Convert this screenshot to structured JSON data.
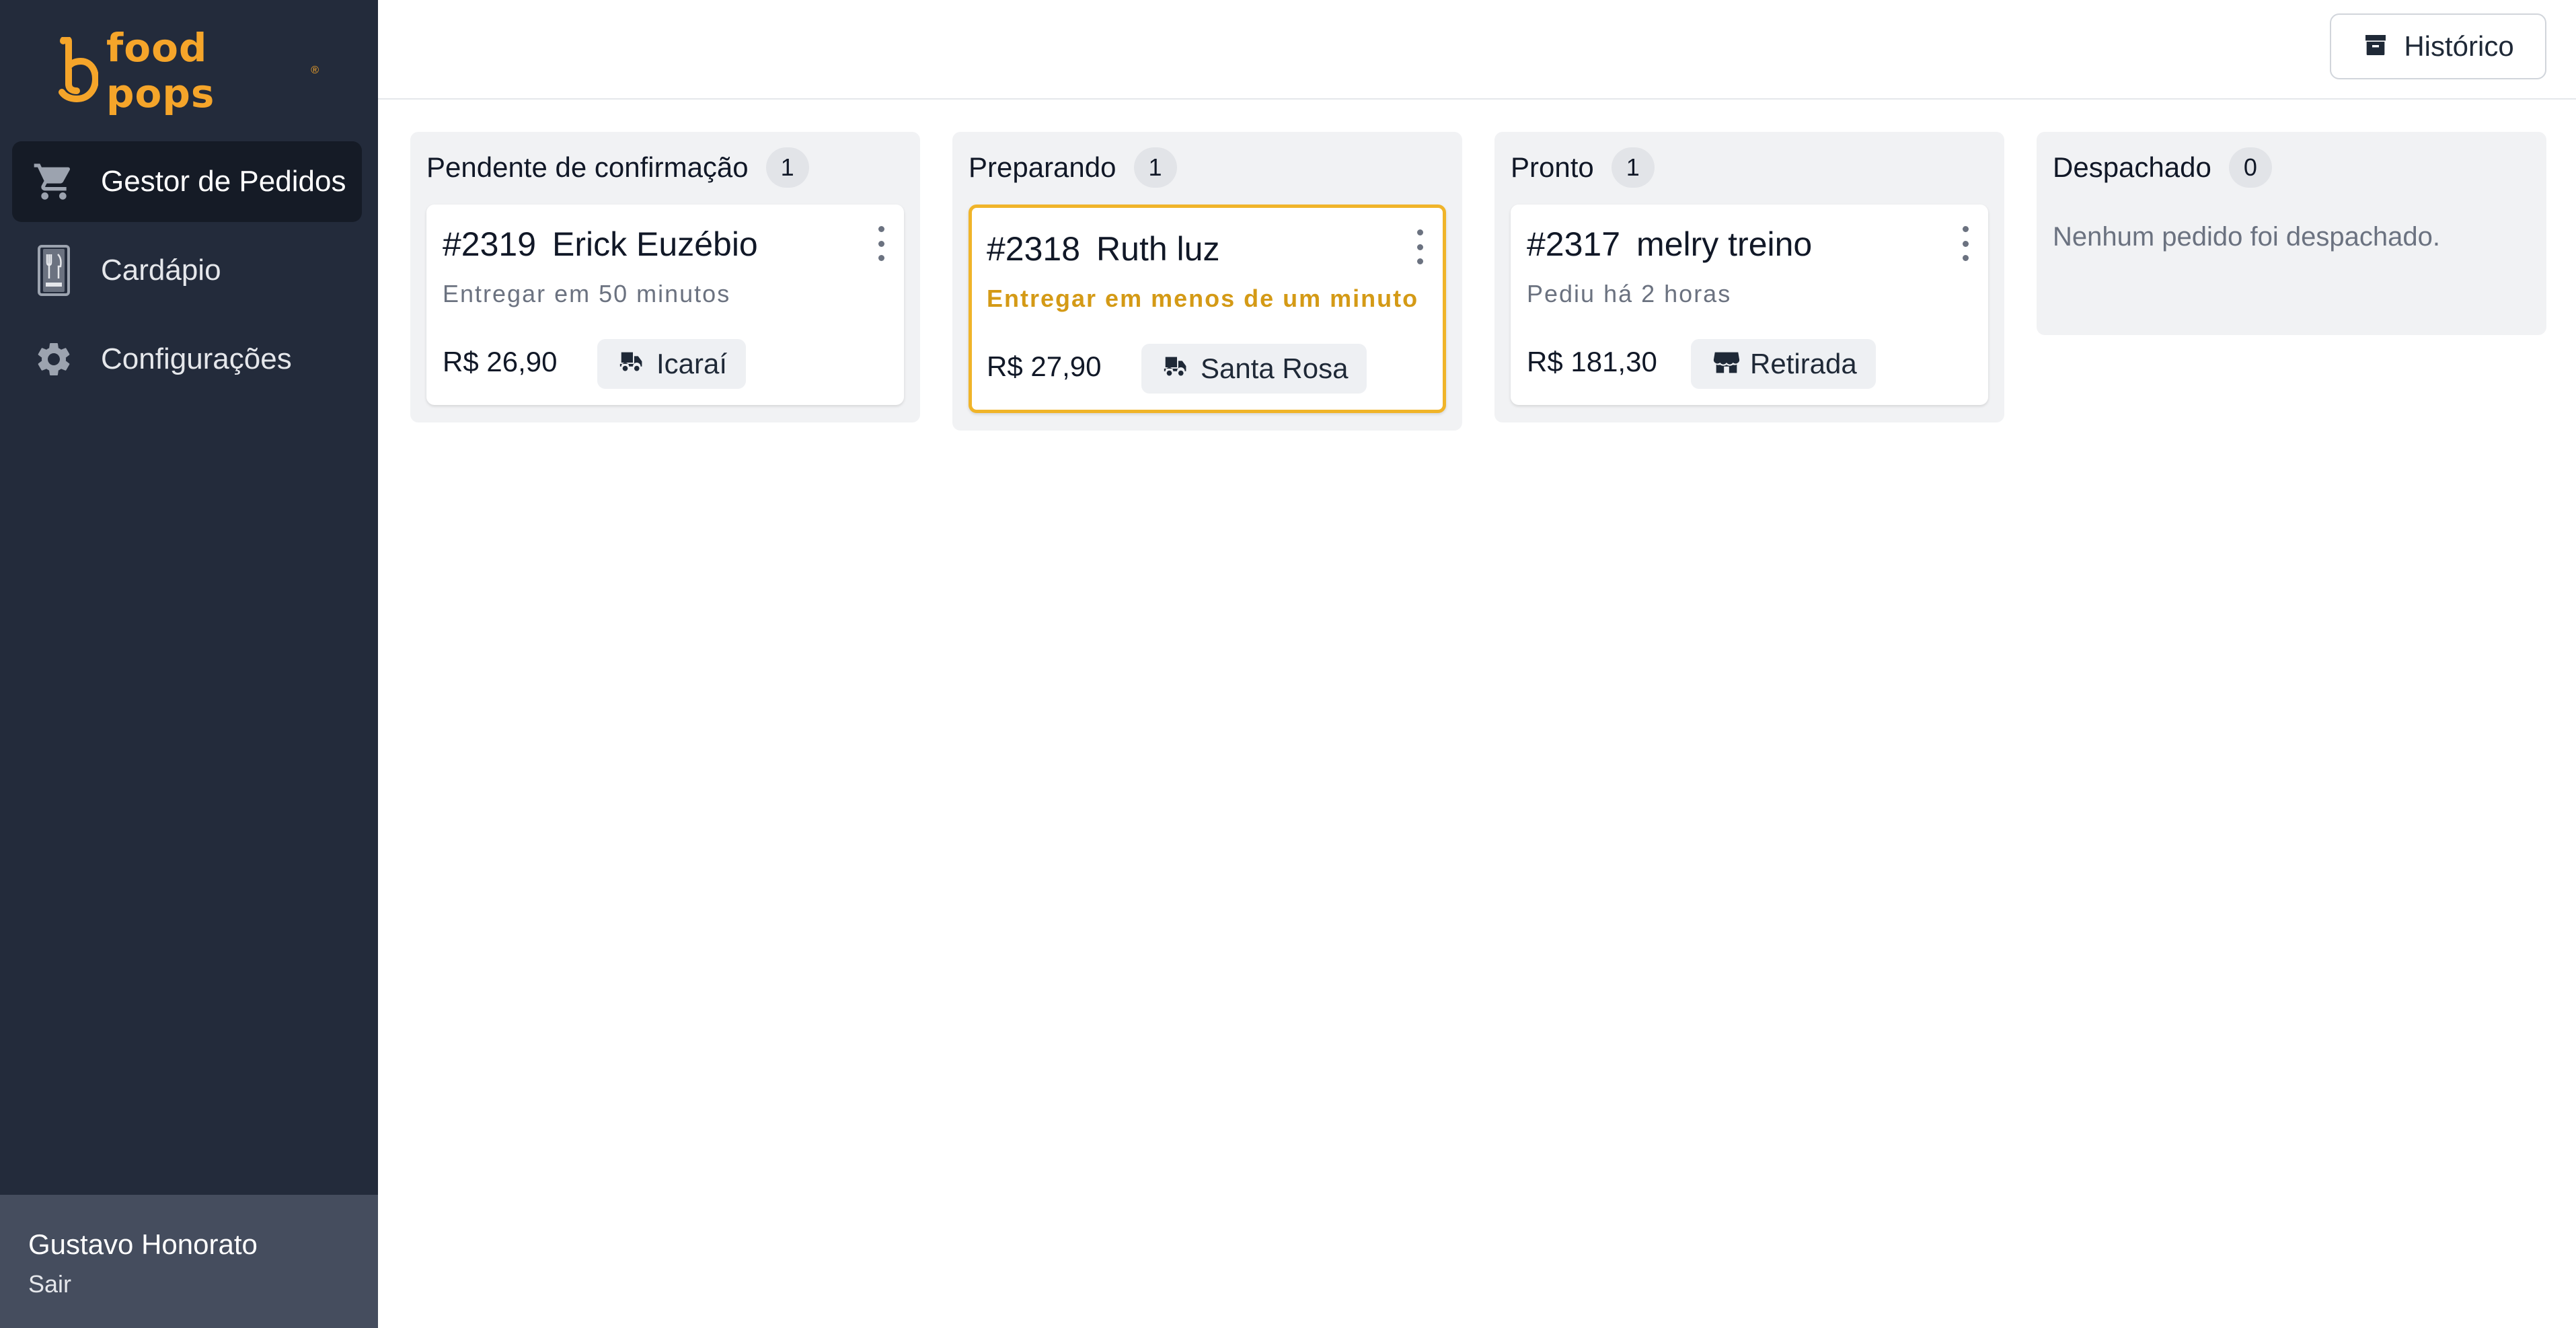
{
  "brand": {
    "name": "food pops",
    "reg": "®",
    "color": "#f5a52a"
  },
  "sidebar": {
    "items": [
      {
        "label": "Gestor de Pedidos",
        "icon": "cart-icon",
        "active": true
      },
      {
        "label": "Cardápio",
        "icon": "menu-book-icon",
        "active": false
      },
      {
        "label": "Configurações",
        "icon": "gear-icon",
        "active": false
      }
    ],
    "user": {
      "name": "Gustavo Honorato",
      "logout_label": "Sair"
    }
  },
  "topbar": {
    "history_label": "Histórico",
    "history_icon": "archive-icon"
  },
  "columns": [
    {
      "title": "Pendente de confirmação",
      "count": "1",
      "cards": [
        {
          "number": "#2319",
          "customer": "Erick Euzébio",
          "status": "Entregar em 50 minutos",
          "price": "R$ 26,90",
          "tag": "Icaraí",
          "tag_icon": "delivery-scooter-icon"
        }
      ]
    },
    {
      "title": "Preparando",
      "count": "1",
      "cards": [
        {
          "number": "#2318",
          "customer": "Ruth luz",
          "status": "Entregar em menos de um minuto",
          "price": "R$ 27,90",
          "tag": "Santa Rosa",
          "tag_icon": "delivery-scooter-icon",
          "highlight_color": "#f0b429"
        }
      ]
    },
    {
      "title": "Pronto",
      "count": "1",
      "cards": [
        {
          "number": "#2317",
          "customer": "melry treino",
          "status": "Pediu há 2 horas",
          "price": "R$ 181,30",
          "tag": "Retirada",
          "tag_icon": "store-icon"
        }
      ]
    },
    {
      "title": "Despachado",
      "count": "0",
      "empty_message": "Nenhum pedido foi despachado."
    }
  ]
}
